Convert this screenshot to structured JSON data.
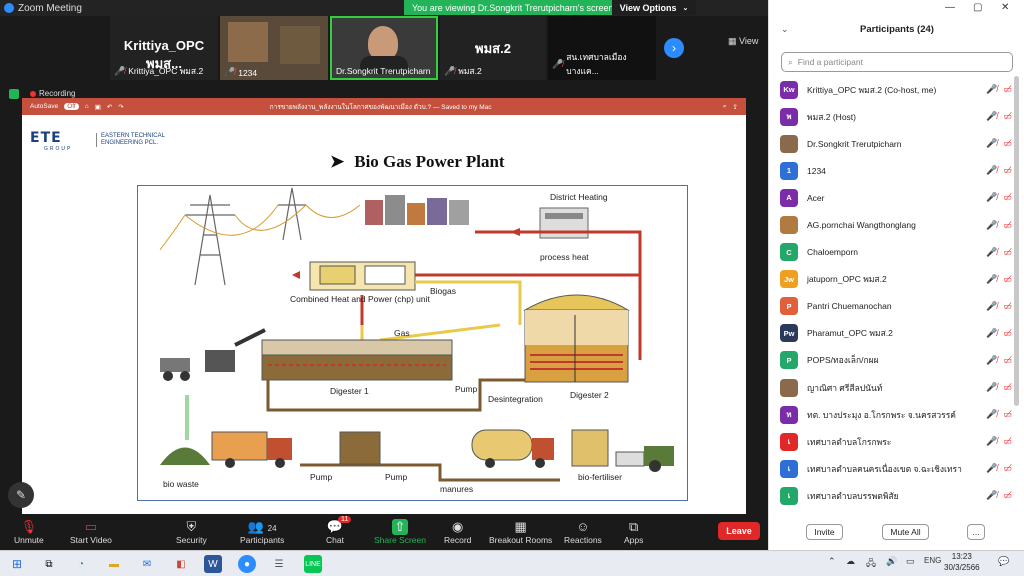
{
  "window": {
    "title": "Zoom Meeting"
  },
  "banner": {
    "viewing": "You are viewing Dr.Songkrit Trerutpicharn's screen",
    "view_options": "View Options"
  },
  "gallery": {
    "tiles": [
      {
        "big": "Krittiya_OPC พมส...",
        "caption": "Krittiya_OPC พมส.2"
      },
      {
        "big": "",
        "caption": "1234"
      },
      {
        "big": "",
        "caption": "Dr.Songkrit Trerutpicharn"
      },
      {
        "big": "พมส.2",
        "caption": "พมส.2"
      },
      {
        "big": "",
        "caption": "สน.เทศบาลเมืองบางแค..."
      }
    ],
    "view_label": "View"
  },
  "recording": "Recording",
  "ppt": {
    "autosave": "AutoSave",
    "autosave_state": "Off",
    "filename": "การขายพลังงาน_พลังงานในโลกาศของพัฒนาเมือง ตัวบ.? — Saved to my Mac"
  },
  "slide": {
    "logo": "ETE",
    "logo_group": "GROUP",
    "company": [
      "EASTERN TECHNICAL",
      "ENGINEERING PCL."
    ],
    "title": "Bio Gas Power Plant",
    "labels": {
      "district_heating": "District Heating",
      "process_heat": "process heat",
      "chp": "Combined Heat and Power (chp) unit",
      "biogas": "Biogas",
      "gas": "Gas",
      "digester1": "Digester 1",
      "pump1": "Pump",
      "desintegration": "Desintegration",
      "digester2": "Digester 2",
      "bio_waste": "bio waste",
      "pump2": "Pump",
      "pump3": "Pump",
      "manures": "manures",
      "bio_fertiliser": "bio-fertiliser"
    }
  },
  "toolbar": {
    "unmute": "Unmute",
    "start_video": "Start Video",
    "security": "Security",
    "participants": "Participants",
    "participants_count": "24",
    "chat": "Chat",
    "chat_badge": "11",
    "share_screen": "Share Screen",
    "record": "Record",
    "breakout": "Breakout Rooms",
    "reactions": "Reactions",
    "apps": "Apps",
    "leave": "Leave"
  },
  "panel": {
    "title": "Participants (24)",
    "search_placeholder": "Find a participant",
    "invite": "Invite",
    "mute_all": "Mute All",
    "more": "...",
    "participants": [
      {
        "initials": "Kw",
        "color": "#7b2ca8",
        "name": "Krittiya_OPC พมส.2 (Co-host, me)"
      },
      {
        "initials": "พ",
        "color": "#7b2ca8",
        "name": "พมส.2 (Host)"
      },
      {
        "initials": "",
        "color": "#8a6a4a",
        "name": "Dr.Songkrit Trerutpicharn"
      },
      {
        "initials": "1",
        "color": "#2d6fd6",
        "name": "1234"
      },
      {
        "initials": "A",
        "color": "#7b2ca8",
        "name": "Acer"
      },
      {
        "initials": "",
        "color": "#b07a40",
        "name": "AG.pornchai  Wangthonglang"
      },
      {
        "initials": "C",
        "color": "#23a86a",
        "name": "Chaloemporn"
      },
      {
        "initials": "Jw",
        "color": "#f0a020",
        "name": "jatuporn_OPC พมส.2"
      },
      {
        "initials": "P",
        "color": "#e0603a",
        "name": "Pantri Chuemanochan"
      },
      {
        "initials": "Pw",
        "color": "#2b3a5a",
        "name": "Pharamut_OPC พมส.2"
      },
      {
        "initials": "P",
        "color": "#23a86a",
        "name": "POPS/ทองเล็ก/กผผ"
      },
      {
        "initials": "",
        "color": "#8a6a4a",
        "name": "ญาณิศา ศรีสีลปนันท์"
      },
      {
        "initials": "ท",
        "color": "#7b2ca8",
        "name": "ทต. บางประมุง อ.โกรกพระ จ.นครสวรรค์"
      },
      {
        "initials": "เ",
        "color": "#e02828",
        "name": "เทศบาลตำบลโกรกพระ"
      },
      {
        "initials": "เ",
        "color": "#2d6fd6",
        "name": "เทศบาลตำบลคนครเนื่องเขต จ.ฉะเชิงเทรา"
      },
      {
        "initials": "เ",
        "color": "#23a86a",
        "name": "เทศบาลตำบลบรรพตพิสัย"
      }
    ]
  },
  "taskbar": {
    "time": "13:23",
    "date": "30/3/2566",
    "lang": "ENG"
  }
}
